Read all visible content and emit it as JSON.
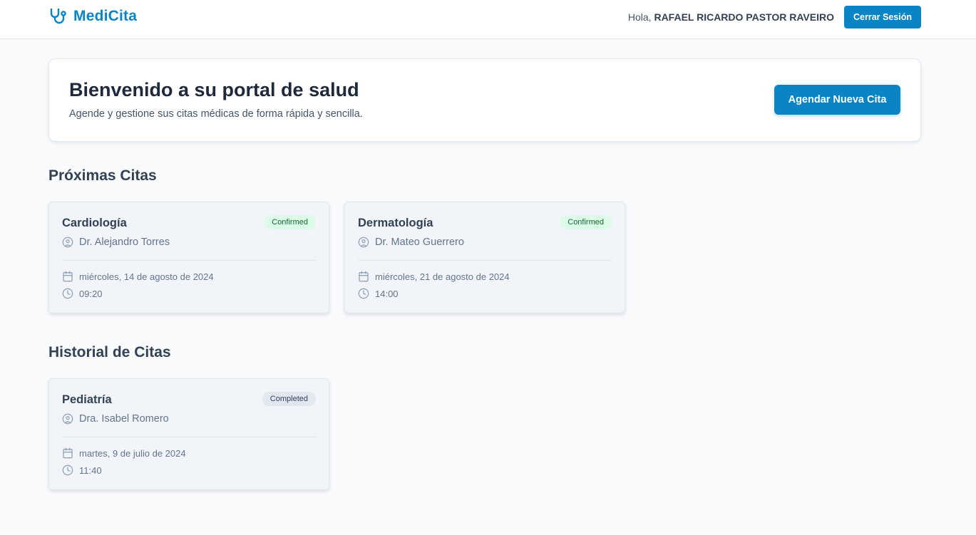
{
  "header": {
    "brand": "MediCita",
    "greeting_prefix": "Hola,",
    "user_name": "RAFAEL RICARDO PASTOR RAVEIRO",
    "logout_label": "Cerrar Sesión"
  },
  "welcome": {
    "title": "Bienvenido a su portal de salud",
    "subtitle": "Agende y gestione sus citas médicas de forma rápida y sencilla.",
    "new_appointment_label": "Agendar Nueva Cita"
  },
  "upcoming": {
    "title": "Próximas Citas",
    "appointments": [
      {
        "specialty": "Cardiología",
        "status": "Confirmed",
        "doctor": "Dr. Alejandro Torres",
        "date": "miércoles, 14 de agosto de 2024",
        "time": "09:20"
      },
      {
        "specialty": "Dermatología",
        "status": "Confirmed",
        "doctor": "Dr. Mateo Guerrero",
        "date": "miércoles, 21 de agosto de 2024",
        "time": "14:00"
      }
    ]
  },
  "history": {
    "title": "Historial de Citas",
    "appointments": [
      {
        "specialty": "Pediatría",
        "status": "Completed",
        "doctor": "Dra. Isabel Romero",
        "date": "martes, 9 de julio de 2024",
        "time": "11:40"
      }
    ]
  },
  "icons": {
    "brand": "stethoscope-icon",
    "doctor": "user-circle-icon",
    "date": "calendar-icon",
    "time": "clock-icon"
  },
  "colors": {
    "primary": "#0b84c6",
    "confirmed_bg": "#dcfce7",
    "confirmed_text": "#166534",
    "completed_bg": "#e2e8f0"
  }
}
